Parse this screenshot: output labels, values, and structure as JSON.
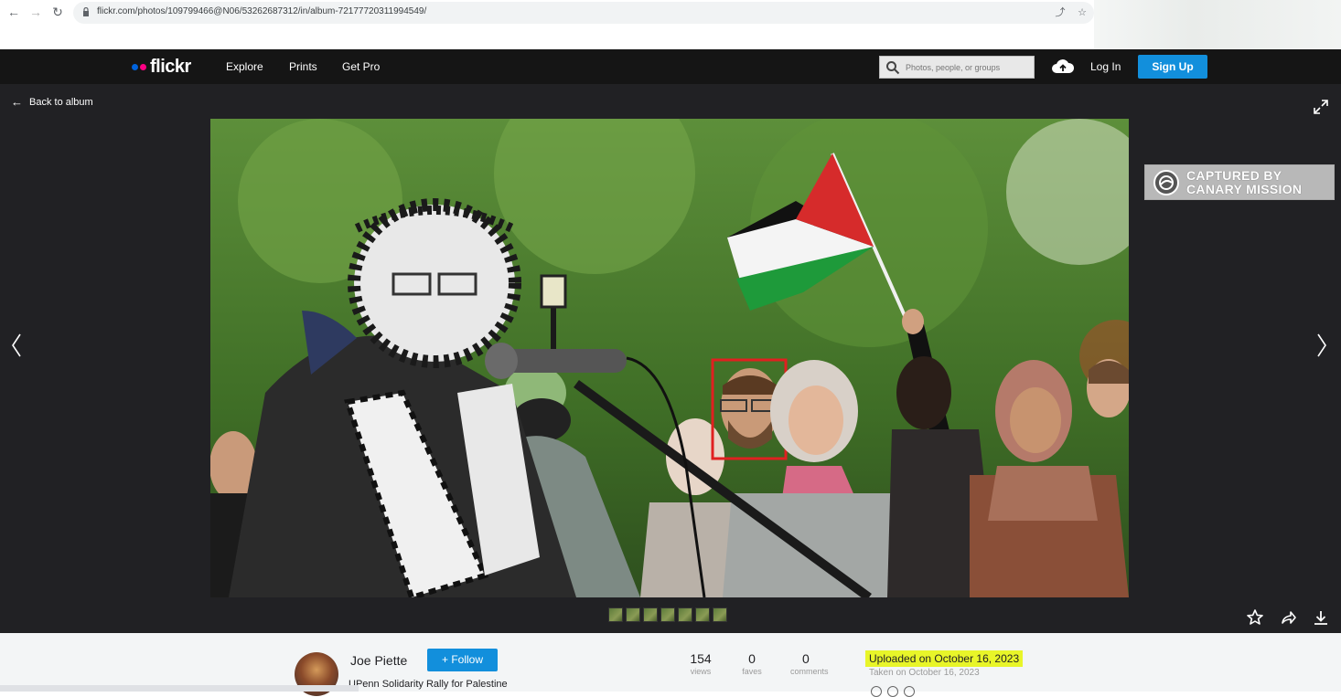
{
  "browser": {
    "url": "flickr.com/photos/109799466@N06/53262687312/in/album-72177720311994549/"
  },
  "header": {
    "logo_text": "flickr",
    "logo_colors": [
      "#0063dc",
      "#ff0084"
    ],
    "nav": [
      "Explore",
      "Prints",
      "Get Pro"
    ],
    "search_placeholder": "Photos, people, or groups",
    "login_label": "Log In",
    "signup_label": "Sign Up",
    "accent_color": "#128fdc"
  },
  "viewer": {
    "back_label": "Back to album",
    "watermark": [
      "CAPTURED BY",
      "CANARY MISSION"
    ]
  },
  "info": {
    "author": "Joe Piette",
    "follow_label": "+ Follow",
    "photo_title": "UPenn Solidarity Rally for Palestine",
    "stats": [
      {
        "value": "154",
        "label": "views"
      },
      {
        "value": "0",
        "label": "faves"
      },
      {
        "value": "0",
        "label": "comments"
      }
    ],
    "uploaded": "Uploaded on October 16, 2023",
    "taken": "Taken on October 16, 2023"
  }
}
